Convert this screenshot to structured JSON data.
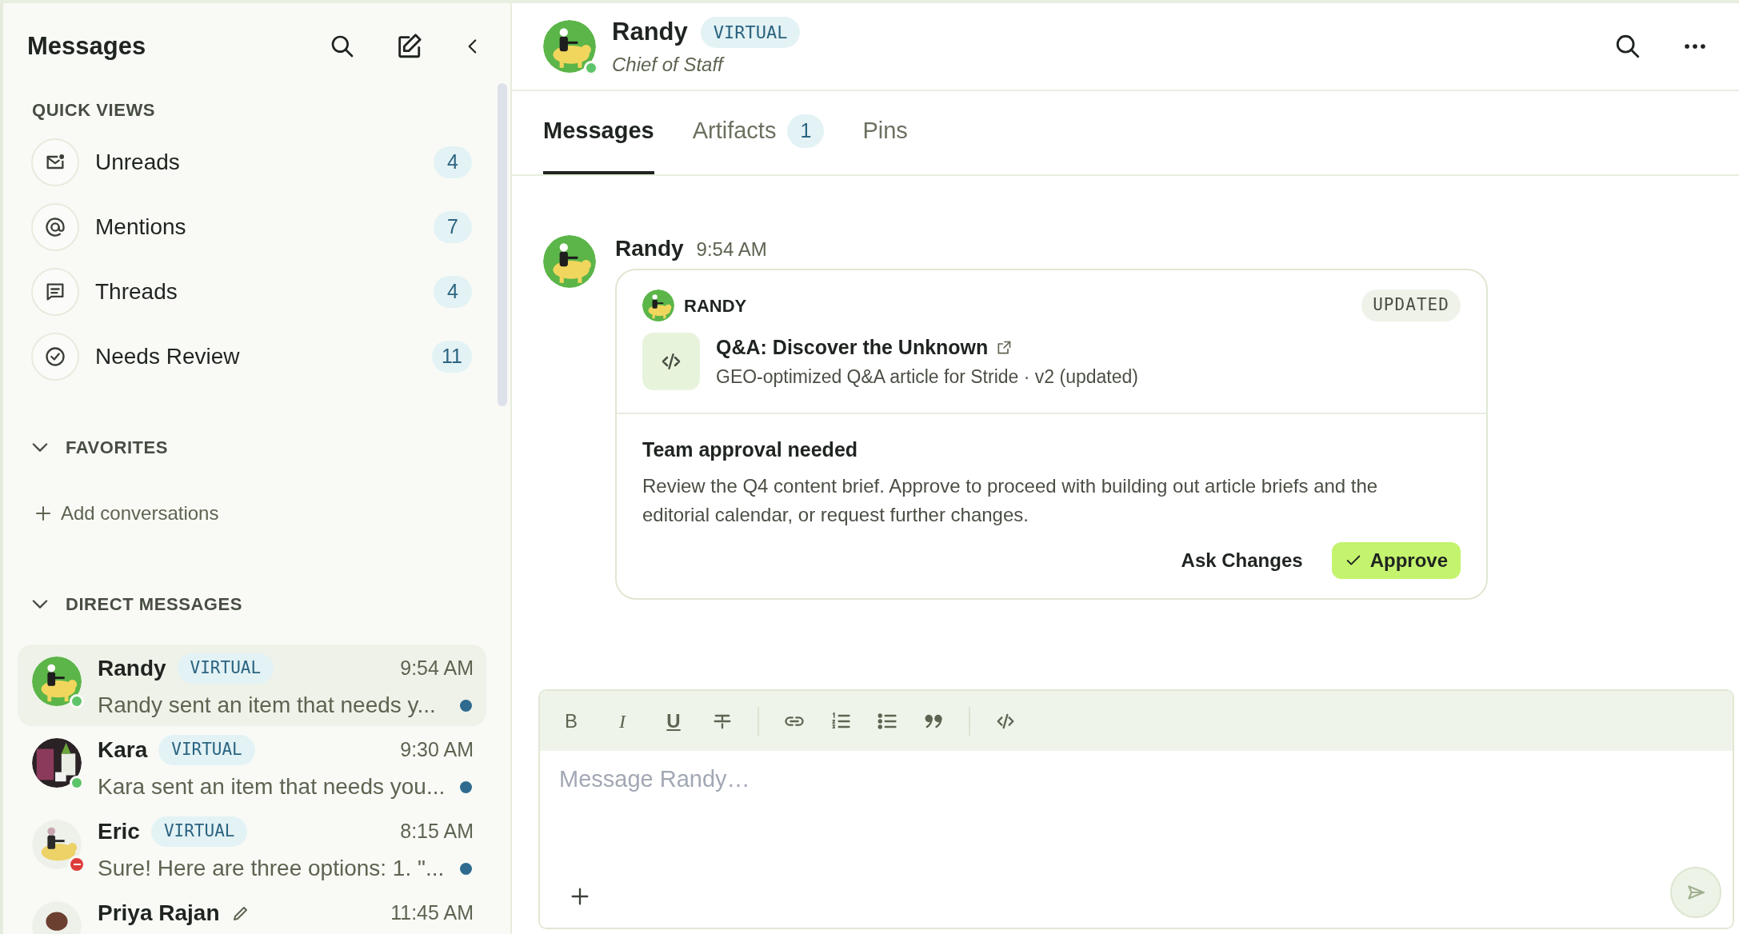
{
  "sidebar": {
    "title": "Messages",
    "quick_views": {
      "heading": "QUICK VIEWS",
      "items": [
        {
          "kind": "unreads",
          "label": "Unreads",
          "count": "4"
        },
        {
          "kind": "mentions",
          "label": "Mentions",
          "count": "7"
        },
        {
          "kind": "threads",
          "label": "Threads",
          "count": "4"
        },
        {
          "kind": "review",
          "label": "Needs Review",
          "count": "11"
        }
      ]
    },
    "favorites": {
      "heading": "FAVORITES",
      "expanded": true,
      "add_label": "Add conversations"
    },
    "direct_messages": {
      "heading": "DIRECT MESSAGES",
      "expanded": true,
      "items": [
        {
          "name": "Randy",
          "badge": "VIRTUAL",
          "time": "9:54 AM",
          "preview": "Randy sent an item that needs y...",
          "unread": true,
          "online": true,
          "do_not_disturb": false,
          "selected": true
        },
        {
          "name": "Kara",
          "badge": "VIRTUAL",
          "time": "9:30 AM",
          "preview": "Kara sent an item that needs you...",
          "unread": true,
          "online": true,
          "do_not_disturb": false,
          "selected": false
        },
        {
          "name": "Eric",
          "badge": "VIRTUAL",
          "time": "8:15 AM",
          "preview": "Sure! Here are three options: 1. \"...",
          "unread": true,
          "online": false,
          "do_not_disturb": true,
          "selected": false
        },
        {
          "name": "Priya Rajan",
          "time": "11:45 AM",
          "editing": true,
          "selected": false
        }
      ]
    }
  },
  "conversation": {
    "name": "Randy",
    "badge": "VIRTUAL",
    "subtitle": "Chief of Staff",
    "online": true,
    "tabs": [
      {
        "label": "Messages",
        "selected": true
      },
      {
        "label": "Artifacts",
        "count": "1",
        "selected": false
      },
      {
        "label": "Pins",
        "selected": false
      }
    ],
    "messages": [
      {
        "author": "Randy",
        "time": "9:54 AM",
        "card": {
          "author": "RANDY",
          "status": "UPDATED",
          "artifact_title": "Q&A: Discover the Unknown",
          "artifact_subtitle": "GEO-optimized Q&A article for Stride · v2 (updated)",
          "heading": "Team approval needed",
          "body": "Review the Q4 content brief. Approve to proceed with building out article briefs and the editorial calendar, or request further changes.",
          "secondary_action": "Ask Changes",
          "primary_action": "Approve"
        }
      }
    ],
    "composer": {
      "toolbar": [
        {
          "kind": "bold",
          "label": "B"
        },
        {
          "kind": "italic",
          "label": "I"
        },
        {
          "kind": "underline",
          "label": "U"
        },
        {
          "kind": "strike"
        },
        {
          "kind": "divider"
        },
        {
          "kind": "link"
        },
        {
          "kind": "ordered"
        },
        {
          "kind": "bullets"
        },
        {
          "kind": "quote"
        },
        {
          "kind": "divider"
        },
        {
          "kind": "code"
        }
      ],
      "placeholder": "Message Randy…"
    }
  }
}
